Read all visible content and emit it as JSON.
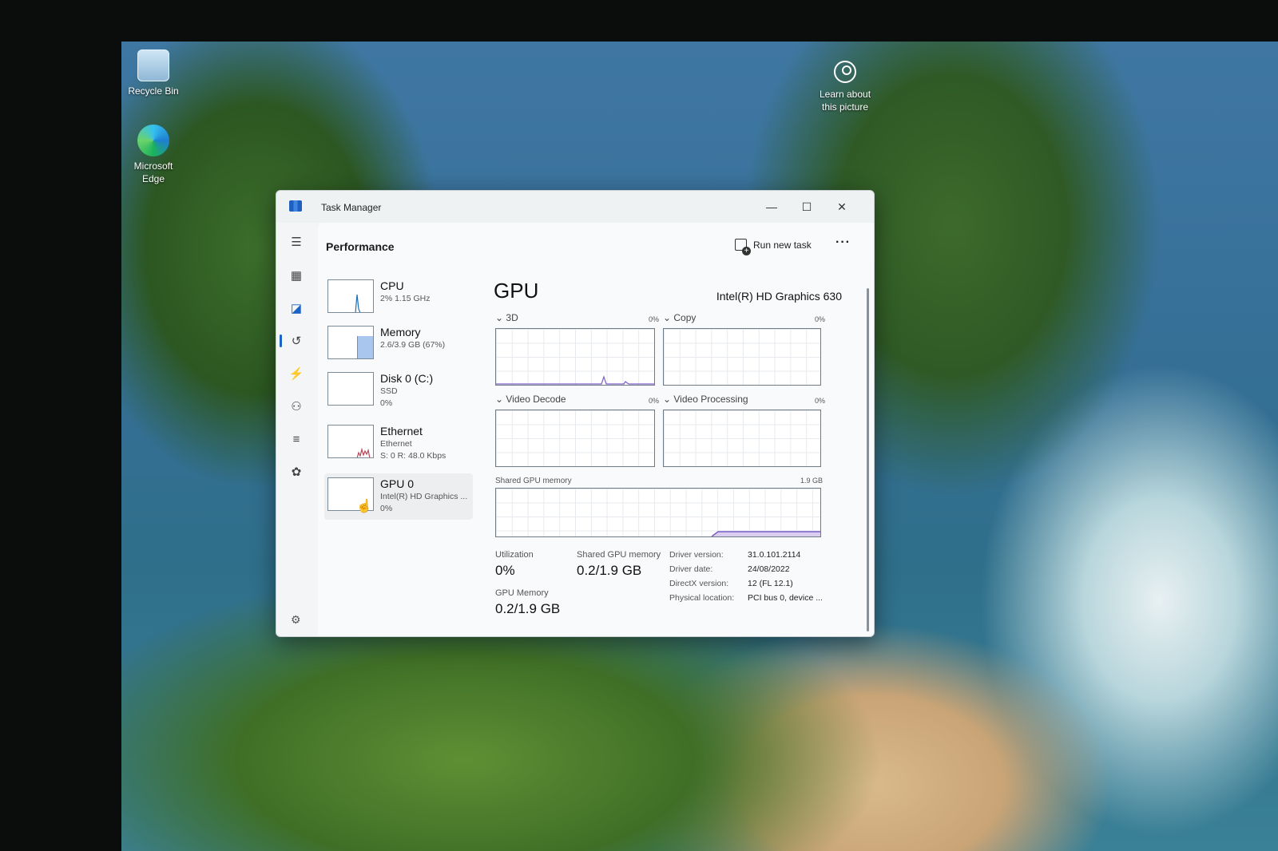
{
  "desktop": {
    "icons": [
      {
        "label": "Recycle Bin",
        "icon": "recycle-bin-icon"
      },
      {
        "label": "Microsoft Edge",
        "icon": "edge-icon"
      }
    ],
    "learn_about": {
      "line1": "Learn about",
      "line2": "this picture",
      "icon": "camera-circle-icon"
    }
  },
  "window": {
    "title": "Task Manager",
    "controls": {
      "minimize": "—",
      "maximize": "☐",
      "close": "✕"
    }
  },
  "nav": {
    "items": [
      {
        "icon": "hamburger-icon",
        "glyph": "☰"
      },
      {
        "icon": "processes-icon",
        "glyph": "▦"
      },
      {
        "icon": "performance-icon",
        "glyph": "◪"
      },
      {
        "icon": "app-history-icon",
        "glyph": "↺"
      },
      {
        "icon": "startup-apps-icon",
        "glyph": "⚡"
      },
      {
        "icon": "users-icon",
        "glyph": "⚇"
      },
      {
        "icon": "details-icon",
        "glyph": "≡"
      },
      {
        "icon": "services-icon",
        "glyph": "✿"
      }
    ],
    "settings_glyph": "⚙",
    "active_index": 2
  },
  "header": {
    "title": "Performance",
    "run_new_task": "Run new task",
    "more": "···"
  },
  "devices": [
    {
      "name": "CPU",
      "sub1": "2% 1.15 GHz",
      "sub2": "",
      "graph_color": "#1a6fb5"
    },
    {
      "name": "Memory",
      "sub1": "2.6/3.9 GB (67%)",
      "sub2": "",
      "graph_color": "#8a4fc2",
      "fill": 0.67
    },
    {
      "name": "Disk 0 (C:)",
      "sub1": "SSD",
      "sub2": "0%",
      "graph_color": "#4a8a2a"
    },
    {
      "name": "Ethernet",
      "sub1": "Ethernet",
      "sub2": "S: 0 R: 48.0 Kbps",
      "graph_color": "#b5475a"
    },
    {
      "name": "GPU 0",
      "sub1": "Intel(R) HD Graphics ...",
      "sub2": "0%",
      "graph_color": "#6a3fb0",
      "selected": true
    }
  ],
  "detail": {
    "title": "GPU",
    "model": "Intel(R) HD Graphics 630",
    "engines": [
      {
        "label": "3D",
        "pct": "0%"
      },
      {
        "label": "Copy",
        "pct": "0%"
      },
      {
        "label": "Video Decode",
        "pct": "0%"
      },
      {
        "label": "Video Processing",
        "pct": "0%"
      }
    ],
    "shared_memory_graph": {
      "label": "Shared GPU memory",
      "max": "1.9 GB"
    },
    "stats": {
      "utilization_label": "Utilization",
      "utilization_value": "0%",
      "shared_label": "Shared GPU memory",
      "shared_value": "0.2/1.9 GB",
      "gpu_memory_label": "GPU Memory",
      "gpu_memory_value": "0.2/1.9 GB"
    },
    "info": [
      {
        "key": "Driver version:",
        "value": "31.0.101.2114"
      },
      {
        "key": "Driver date:",
        "value": "24/08/2022"
      },
      {
        "key": "DirectX version:",
        "value": "12 (FL 12.1)"
      },
      {
        "key": "Physical location:",
        "value": "PCI bus 0, device ..."
      }
    ]
  }
}
